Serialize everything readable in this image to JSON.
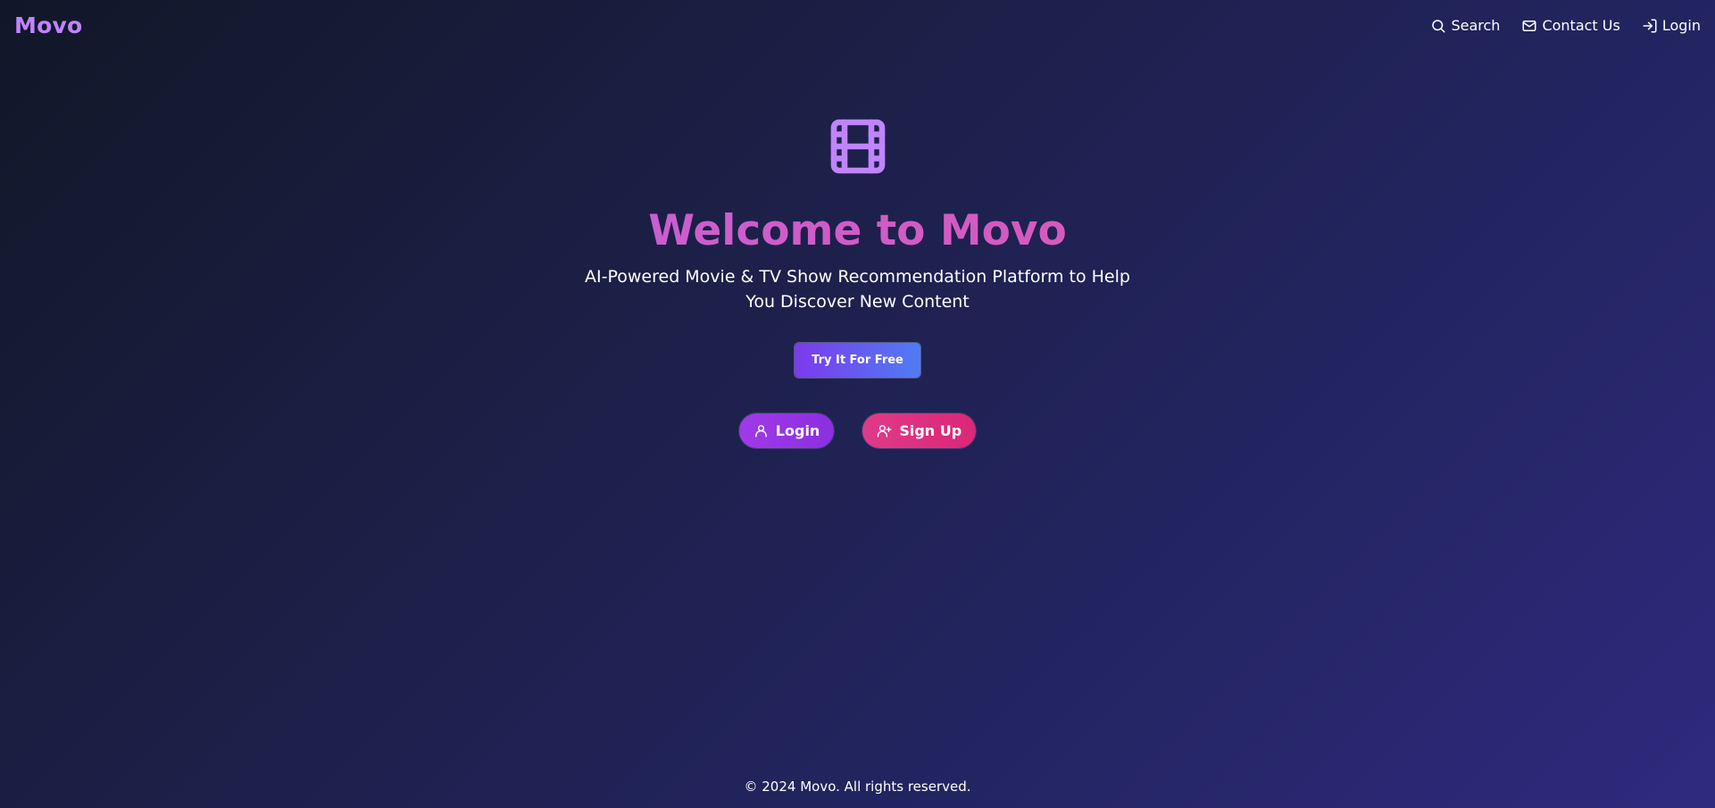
{
  "nav": {
    "logo": "Movo",
    "links": [
      {
        "label": "Search",
        "icon": "search-icon"
      },
      {
        "label": "Contact Us",
        "icon": "mail-icon"
      },
      {
        "label": "Login",
        "icon": "login-icon"
      }
    ]
  },
  "hero": {
    "icon": "film-icon",
    "title": "Welcome to Movo",
    "subtitle": "AI-Powered Movie & TV Show Recommendation Platform to Help You Discover New Content",
    "cta_label": "Try It For Free",
    "login_label": "Login",
    "signup_label": "Sign Up"
  },
  "footer": {
    "copyright": "© 2024 Movo. All rights reserved."
  },
  "colors": {
    "accent_purple": "#c084fc",
    "title_gradient_start": "#b566e8",
    "title_gradient_end": "#e0559f",
    "cta_gradient_start": "#7c3aed",
    "cta_gradient_end": "#4f7cf5",
    "login_button": "#9333ea",
    "signup_button": "#db2777",
    "background_dark": "#111728",
    "background_light": "#2f2a7e"
  }
}
